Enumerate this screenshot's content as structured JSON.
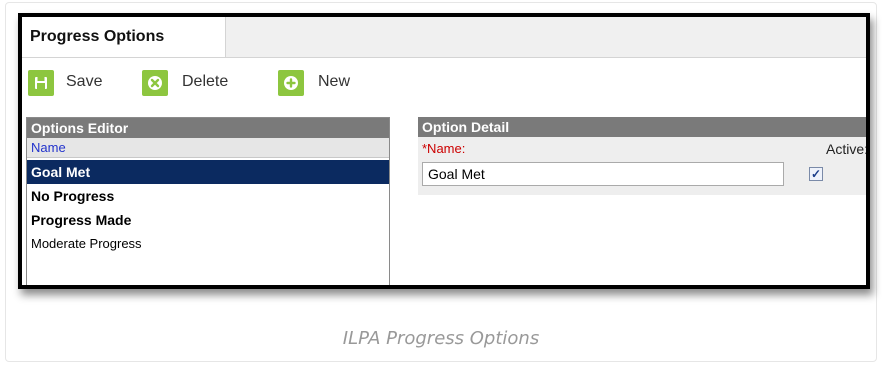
{
  "tab": {
    "label": "Progress Options"
  },
  "toolbar": {
    "save_label": "Save",
    "delete_label": "Delete",
    "new_label": "New"
  },
  "options_editor": {
    "title": "Options Editor",
    "column_header": "Name",
    "items": [
      {
        "label": "Goal Met",
        "selected": true,
        "bold": true
      },
      {
        "label": "No Progress",
        "selected": false,
        "bold": true
      },
      {
        "label": "Progress Made",
        "selected": false,
        "bold": true
      },
      {
        "label": "Moderate Progress",
        "selected": false,
        "bold": false
      }
    ]
  },
  "option_detail": {
    "title": "Option Detail",
    "name_label": "*Name:",
    "name_value": "Goal Met",
    "active_label": "Active:",
    "active_checked": true
  },
  "caption": "ILPA Progress Options",
  "colors": {
    "accent_green": "#8dc63f",
    "selection_navy": "#0b2a60",
    "panel_header_gray": "#7a7a7a",
    "required_red": "#cc0000"
  }
}
